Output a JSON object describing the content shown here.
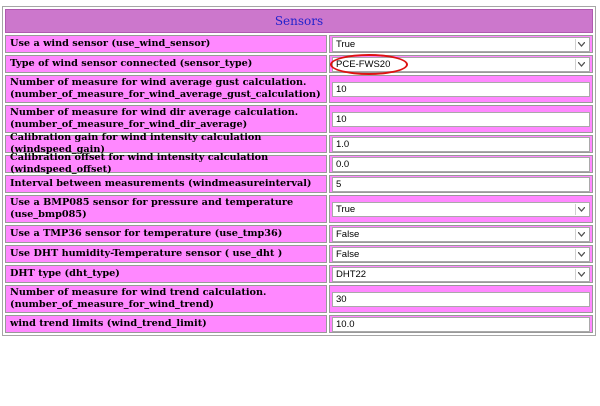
{
  "header": {
    "title": "Sensors"
  },
  "rows": [
    {
      "label": "Use a wind sensor (use_wind_sensor)",
      "type": "select",
      "value": "True"
    },
    {
      "label": "Type of wind sensor connected (sensor_type)",
      "type": "select",
      "value": "PCE-FWS20",
      "highlighted": true
    },
    {
      "label": "Number of measure for wind average gust calculation. (number_of_measure_for_wind_average_gust_calculation)",
      "type": "text",
      "value": "10"
    },
    {
      "label": "Number of measure for wind dir average calculation. (number_of_measure_for_wind_dir_average)",
      "type": "text",
      "value": "10"
    },
    {
      "label": "Calibration gain for wind intensity calculation (windspeed_gain)",
      "type": "text",
      "value": "1.0"
    },
    {
      "label": "Calibration offset for wind intensity calculation (windspeed_offset)",
      "type": "text",
      "value": "0.0"
    },
    {
      "label": "Interval between measurements (windmeasureinterval)",
      "type": "text",
      "value": "5"
    },
    {
      "label": "Use a BMP085 sensor for pressure and temperature (use_bmp085)",
      "type": "select",
      "value": "True"
    },
    {
      "label": "Use a TMP36 sensor for temperature (use_tmp36)",
      "type": "select",
      "value": "False"
    },
    {
      "label": "Use DHT humidity-Temperature sensor ( use_dht )",
      "type": "select",
      "value": "False"
    },
    {
      "label": "DHT type (dht_type)",
      "type": "select",
      "value": "DHT22"
    },
    {
      "label": "Number of measure for wind trend calculation. (number_of_measure_for_wind_trend)",
      "type": "text",
      "value": "30"
    },
    {
      "label": "wind trend limits (wind_trend_limit)",
      "type": "text",
      "value": "10.0"
    }
  ],
  "icons": {
    "dropdown": "chevron-down-icon"
  },
  "colors": {
    "row_bg": "#ff88ff",
    "header_bg": "#cc77cc",
    "header_text": "#2222cc",
    "highlight": "#dd1111"
  }
}
